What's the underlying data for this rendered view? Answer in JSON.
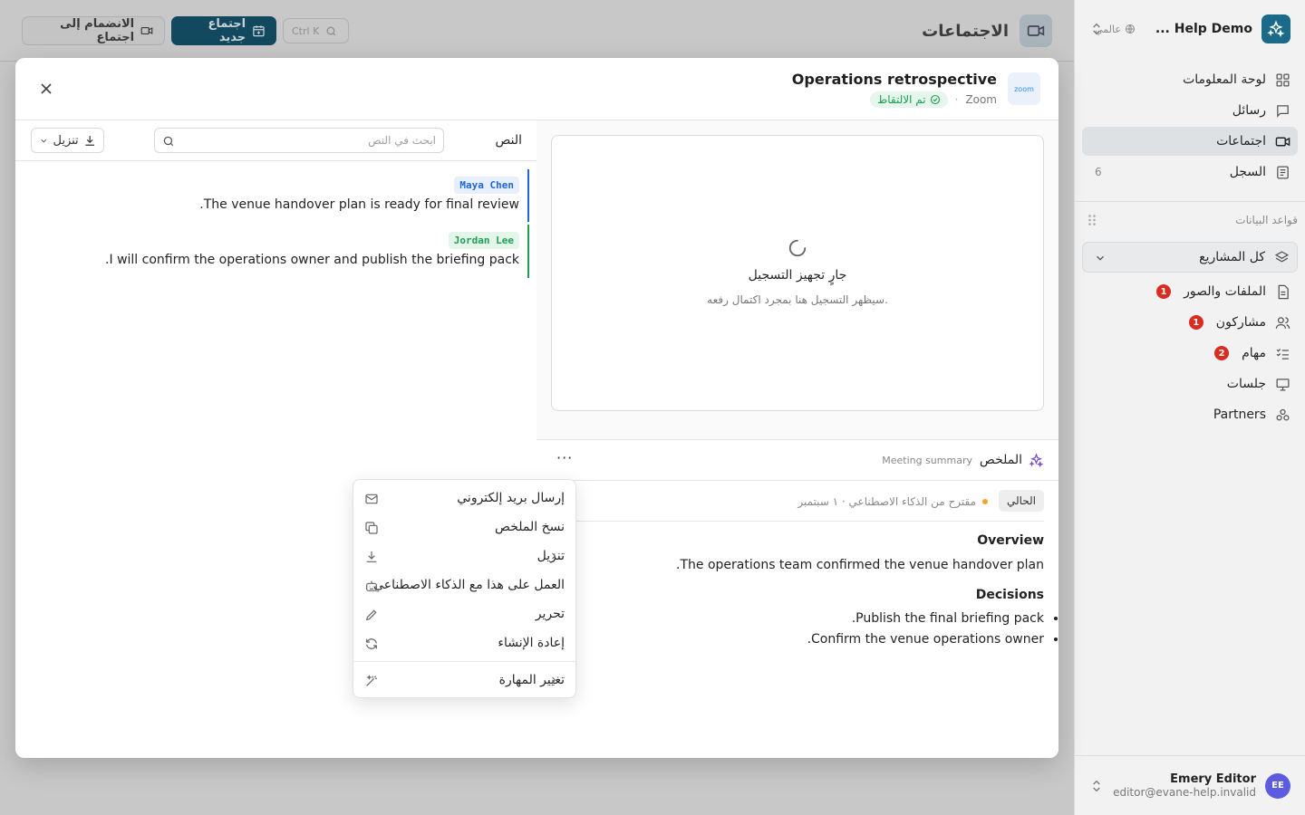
{
  "main": {
    "title": "الاجتماعات",
    "join_button": "الانضمام إلى اجتماع",
    "new_button": "اجتماع جديد",
    "shortcut": "Ctrl K"
  },
  "sidebar": {
    "workspace_name": "Help Demo ...",
    "workspace_scope": "عالمي",
    "nav": [
      {
        "label": "لوحة المعلومات",
        "icon": "dashboard-icon"
      },
      {
        "label": "رسائل",
        "icon": "message-icon"
      },
      {
        "label": "اجتماعات",
        "icon": "video-icon"
      },
      {
        "label": "السجل",
        "icon": "log-icon",
        "count": "6"
      }
    ],
    "databases_label": "قواعد البيانات",
    "project_select": "كل المشاريع",
    "db_items": [
      {
        "label": "الملفات والصور",
        "badge": "1"
      },
      {
        "label": "مشاركون",
        "badge": "1"
      },
      {
        "label": "مهام",
        "badge": "2"
      },
      {
        "label": "جلسات"
      },
      {
        "label": "Partners"
      }
    ],
    "user": {
      "initials": "EE",
      "name": "Emery Editor",
      "email": "editor@evane-help.invalid"
    }
  },
  "modal": {
    "logo_text": "zoom",
    "title": "Operations retrospective",
    "platform": "Zoom",
    "status": "تم الالتقاط",
    "transcript": {
      "label": "النص",
      "search_placeholder": "ابحث في النص",
      "download": "تنزيل",
      "segments": [
        {
          "speaker": "Maya Chen",
          "text": "The venue handover plan is ready for final review."
        },
        {
          "speaker": "Jordan Lee",
          "text": "I will confirm the operations owner and publish the briefing pack."
        }
      ]
    },
    "recording": {
      "title": "جارٍ تجهيز التسجيل",
      "subtitle": "سيظهر التسجيل هنا بمجرد اكتمال رفعه."
    },
    "summary": {
      "label": "الملخص",
      "subtitle": "Meeting summary",
      "more": "···",
      "version_tab": "الحالي",
      "version_meta": "مقترح من الذكاء الاصطناعي · ١ سبتمبر",
      "overview_heading": "Overview",
      "overview_text": "The operations team confirmed the venue handover plan.",
      "decisions_heading": "Decisions",
      "decisions": [
        "Publish the final briefing pack.",
        "Confirm the venue operations owner."
      ]
    },
    "menu": [
      {
        "label": "إرسال بريد إلكتروني",
        "icon": "mail-icon"
      },
      {
        "label": "نسخ الملخص",
        "icon": "copy-icon"
      },
      {
        "label": "تنزيل",
        "icon": "download-icon",
        "submenu": true
      },
      {
        "label": "العمل على هذا مع الذكاء الاصطناعي",
        "icon": "robot-icon"
      },
      {
        "label": "تحرير",
        "icon": "pencil-icon"
      },
      {
        "label": "إعادة الإنشاء",
        "icon": "refresh-icon"
      },
      {
        "label": "تغيير المهارة",
        "icon": "wand-icon",
        "submenu": true
      }
    ]
  },
  "colors": {
    "brand": "#1b6a88",
    "accent": "#13495e",
    "captured": "#1e9e55",
    "badge": "#d92d20"
  }
}
